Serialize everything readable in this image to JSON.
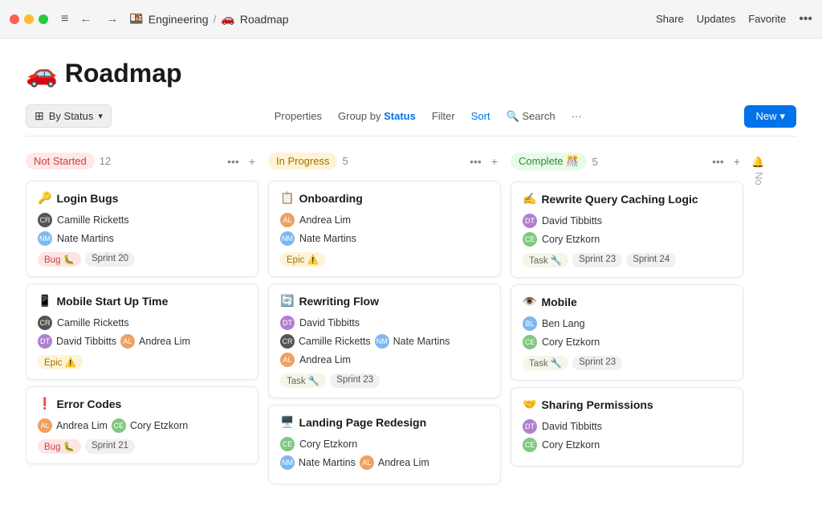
{
  "titlebar": {
    "breadcrumb_engineering": "Engineering",
    "breadcrumb_sep": "/",
    "breadcrumb_roadmap": "Roadmap",
    "breadcrumb_emoji": "🚗",
    "action_share": "Share",
    "action_updates": "Updates",
    "action_favorite": "Favorite",
    "emoji_engineering": "🍱"
  },
  "page": {
    "title": "🚗 Roadmap"
  },
  "toolbar": {
    "by_status": "By Status",
    "properties": "Properties",
    "group_by": "Group by",
    "group_by_field": "Status",
    "filter": "Filter",
    "sort": "Sort",
    "search": "Search",
    "new": "New",
    "more": "···"
  },
  "columns": [
    {
      "id": "not-started",
      "title": "Not Started",
      "count": "12",
      "badge_class": "badge-not-started",
      "cards": [
        {
          "emoji": "🔑",
          "title": "Login Bugs",
          "persons": [
            {
              "name": "Camille Ricketts",
              "avatar_class": "avatar-dark"
            },
            {
              "name": "Nate Martins",
              "avatar_class": "avatar-blue"
            }
          ],
          "tags": [
            {
              "label": "Bug 🐛",
              "class": "tag-bug"
            },
            {
              "label": "Sprint 20",
              "class": "tag-sprint"
            }
          ]
        },
        {
          "emoji": "📱",
          "title": "Mobile Start Up Time",
          "persons": [
            {
              "name": "Camille Ricketts",
              "avatar_class": "avatar-dark"
            },
            {
              "name": "David Tibbitts",
              "avatar_class": "avatar-purple"
            },
            {
              "name": "Andrea Lim",
              "avatar_class": "avatar-orange"
            }
          ],
          "tags": [
            {
              "label": "Epic ⚠️",
              "class": "tag-epic"
            }
          ]
        },
        {
          "emoji": "❗",
          "title": "Error Codes",
          "persons": [
            {
              "name": "Andrea Lim",
              "avatar_class": "avatar-orange"
            },
            {
              "name": "Cory Etzkorn",
              "avatar_class": "avatar-green"
            }
          ],
          "tags": [
            {
              "label": "Bug 🐛",
              "class": "tag-bug"
            },
            {
              "label": "Sprint 21",
              "class": "tag-sprint"
            }
          ]
        }
      ]
    },
    {
      "id": "in-progress",
      "title": "In Progress",
      "count": "5",
      "badge_class": "badge-in-progress",
      "cards": [
        {
          "emoji": "📋",
          "title": "Onboarding",
          "persons": [
            {
              "name": "Andrea Lim",
              "avatar_class": "avatar-orange"
            },
            {
              "name": "Nate Martins",
              "avatar_class": "avatar-blue"
            }
          ],
          "tags": [
            {
              "label": "Epic ⚠️",
              "class": "tag-epic"
            }
          ]
        },
        {
          "emoji": "🔄",
          "title": "Rewriting Flow",
          "persons": [
            {
              "name": "David Tibbitts",
              "avatar_class": "avatar-purple"
            },
            {
              "name": "Camille Ricketts",
              "avatar_class": "avatar-dark"
            },
            {
              "name": "Nate Martins",
              "avatar_class": "avatar-blue"
            },
            {
              "name": "Andrea Lim",
              "avatar_class": "avatar-orange"
            }
          ],
          "tags": [
            {
              "label": "Task 🔧",
              "class": "tag-task"
            },
            {
              "label": "Sprint 23",
              "class": "tag-sprint"
            }
          ]
        },
        {
          "emoji": "🖥️",
          "title": "Landing Page Redesign",
          "persons": [
            {
              "name": "Cory Etzkorn",
              "avatar_class": "avatar-green"
            },
            {
              "name": "Nate Martins",
              "avatar_class": "avatar-blue"
            },
            {
              "name": "Andrea Lim",
              "avatar_class": "avatar-orange"
            }
          ],
          "tags": []
        }
      ]
    },
    {
      "id": "complete",
      "title": "Complete 🎊",
      "count": "5",
      "badge_class": "badge-complete",
      "cards": [
        {
          "emoji": "✍️",
          "title": "Rewrite Query Caching Logic",
          "persons": [
            {
              "name": "David Tibbitts",
              "avatar_class": "avatar-purple"
            },
            {
              "name": "Cory Etzkorn",
              "avatar_class": "avatar-green"
            }
          ],
          "tags": [
            {
              "label": "Task 🔧",
              "class": "tag-task"
            },
            {
              "label": "Sprint 23",
              "class": "tag-sprint"
            },
            {
              "label": "Sprint 24",
              "class": "tag-sprint"
            }
          ]
        },
        {
          "emoji": "👁️",
          "title": "Mobile",
          "persons": [
            {
              "name": "Ben Lang",
              "avatar_class": "avatar-blue"
            },
            {
              "name": "Cory Etzkorn",
              "avatar_class": "avatar-green"
            }
          ],
          "tags": [
            {
              "label": "Task 🔧",
              "class": "tag-task"
            },
            {
              "label": "Sprint 23",
              "class": "tag-sprint"
            }
          ]
        },
        {
          "emoji": "🤝",
          "title": "Sharing Permissions",
          "persons": [
            {
              "name": "David Tibbitts",
              "avatar_class": "avatar-purple"
            },
            {
              "name": "Cory Etzkorn",
              "avatar_class": "avatar-green"
            }
          ],
          "tags": []
        }
      ]
    }
  ],
  "hidden": {
    "label": "No",
    "icon": "🔔"
  }
}
